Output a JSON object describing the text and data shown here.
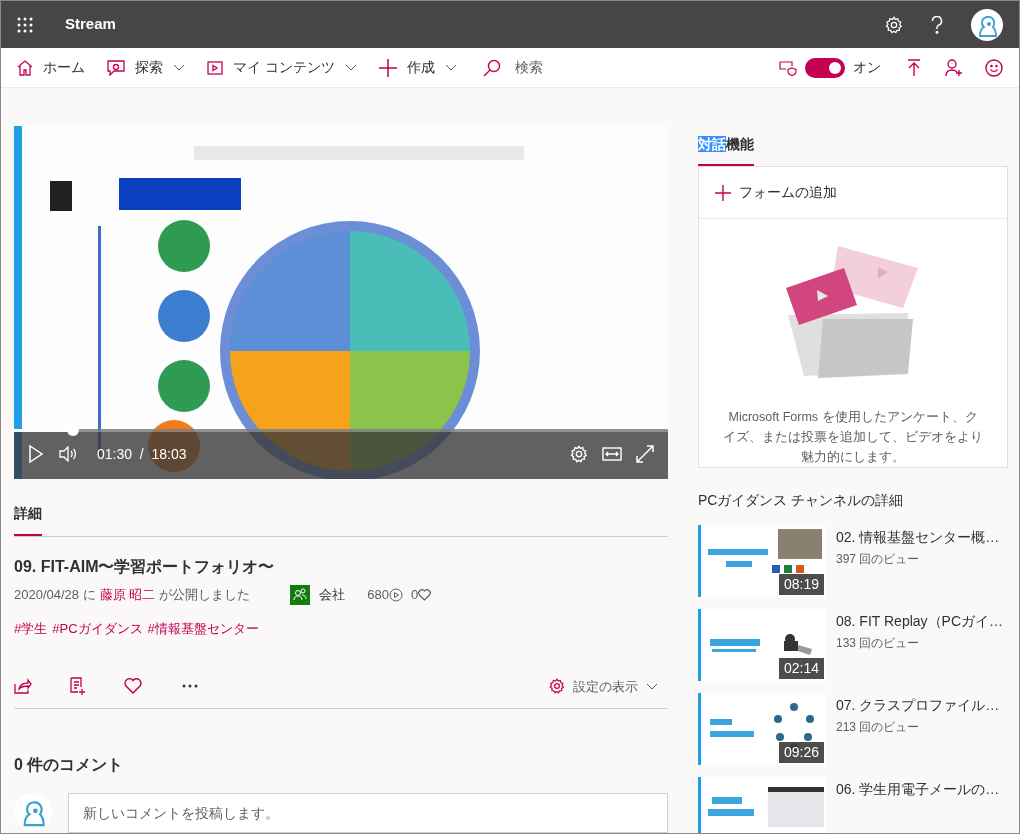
{
  "app_bar": {
    "title": "Stream"
  },
  "nav": {
    "items": [
      {
        "label": "ホーム",
        "dropdown": false
      },
      {
        "label": "探索",
        "dropdown": true
      },
      {
        "label": "マイ コンテンツ",
        "dropdown": true
      },
      {
        "label": "作成",
        "dropdown": true
      }
    ],
    "search": {
      "placeholder": "検索"
    },
    "toggle": {
      "on": true,
      "label": "オン"
    }
  },
  "video": {
    "kind": "picture",
    "level": 0.09,
    "time": "01:30",
    "separator": "/",
    "duration": "18:03"
  },
  "details_tab": {
    "label": "詳細",
    "selected": true
  },
  "title": "09. FIT-AIM〜学習ポートフォリオ〜",
  "published": {
    "date": "2020/04/28 に",
    "author": "藤原 昭二",
    "suffix": "が公開しました"
  },
  "visibility": "会社",
  "views": "680",
  "likes": "0",
  "hashtags": [
    "#学生",
    "#PCガイダンス",
    "#情報基盤センター"
  ],
  "settings_button": "設定の表示",
  "comments": {
    "heading": "0 件のコメント",
    "placeholder": "新しいコメントを投稿します。"
  },
  "side_tab": {
    "highlighted": "対話",
    "rest": "機能",
    "selected": true
  },
  "forms": {
    "add": "フォームの追加",
    "description": "Microsoft Forms を使用したアンケート、クイズ、または投票を追加して、ビデオをより魅力的にします。"
  },
  "channel": {
    "heading": "PCガイダンス チャンネルの詳細",
    "videos": [
      {
        "title": "02. 情報基盤センター概…",
        "views": "397 回のビュー",
        "duration": "08:19"
      },
      {
        "title": "08. FIT Replay（PCガイ…",
        "views": "133 回のビュー",
        "duration": "02:14"
      },
      {
        "title": "07. クラスプロファイル…",
        "views": "213 回のビュー",
        "duration": "09:26"
      },
      {
        "title": "06. 学生用電子メールの…"
      }
    ]
  }
}
